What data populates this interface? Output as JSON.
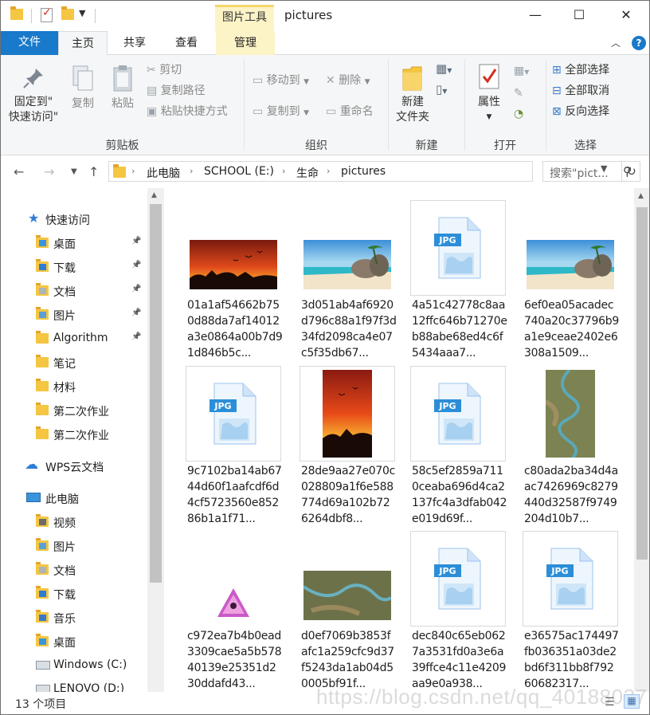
{
  "window": {
    "title": "pictures",
    "context_tab": "图片工具"
  },
  "tabs": {
    "file": "文件",
    "home": "主页",
    "share": "共享",
    "view": "查看",
    "manage": "管理"
  },
  "ribbon": {
    "clipboard": {
      "label": "剪贴板",
      "pin": "固定到\"\n快速访问\"",
      "pin_line1": "固定到\"",
      "pin_line2": "快速访问\"",
      "copy": "复制",
      "paste": "粘贴",
      "cut": "剪切",
      "copy_path": "复制路径",
      "paste_shortcut": "粘贴快捷方式"
    },
    "organize": {
      "label": "组织",
      "move_to": "移动到",
      "copy_to": "复制到",
      "delete": "删除",
      "rename": "重命名"
    },
    "new": {
      "label": "新建",
      "new_folder_line1": "新建",
      "new_folder_line2": "文件夹"
    },
    "open": {
      "label": "打开",
      "properties": "属性"
    },
    "select": {
      "label": "选择",
      "select_all": "全部选择",
      "select_none": "全部取消",
      "invert": "反向选择"
    }
  },
  "address": {
    "crumbs": [
      "此电脑",
      "SCHOOL (E:)",
      "生命",
      "pictures"
    ],
    "search_placeholder": "搜索\"pict..."
  },
  "nav": {
    "quick_access": "快速访问",
    "quick_items": [
      {
        "label": "桌面",
        "icon": "desktop-folder-icon",
        "pinned": true
      },
      {
        "label": "下载",
        "icon": "download-folder-icon",
        "pinned": true
      },
      {
        "label": "文档",
        "icon": "documents-folder-icon",
        "pinned": true
      },
      {
        "label": "图片",
        "icon": "pictures-folder-icon",
        "pinned": true
      },
      {
        "label": "Algorithm",
        "icon": "folder-icon",
        "pinned": true
      },
      {
        "label": "笔记",
        "icon": "folder-icon",
        "pinned": false
      },
      {
        "label": "材料",
        "icon": "folder-icon",
        "pinned": false
      },
      {
        "label": "第二次作业",
        "icon": "folder-icon",
        "pinned": false
      },
      {
        "label": "第二次作业",
        "icon": "folder-icon",
        "pinned": false
      }
    ],
    "wps": "WPS云文档",
    "this_pc": "此电脑",
    "pc_items": [
      {
        "label": "视频",
        "icon": "videos-folder-icon"
      },
      {
        "label": "图片",
        "icon": "pictures-folder-icon"
      },
      {
        "label": "文档",
        "icon": "documents-folder-icon"
      },
      {
        "label": "下载",
        "icon": "download-folder-icon"
      },
      {
        "label": "音乐",
        "icon": "music-folder-icon"
      },
      {
        "label": "桌面",
        "icon": "desktop-folder-icon"
      },
      {
        "label": "Windows (C:)",
        "icon": "drive-icon"
      },
      {
        "label": "LENOVO (D:)",
        "icon": "drive-icon"
      }
    ]
  },
  "files": [
    {
      "name": "01a1af54662b750d88da7af14012a3e0864a00b7d91d846b5c...",
      "thumb": "sunset"
    },
    {
      "name": "3d051ab4af6920d796c88a1f97f3d34fd2098ca4e07c5f35db67...",
      "thumb": "beach"
    },
    {
      "name": "4a51c42778c8aa12ffc646b71270eb88abe68ed4c6f5434aaa7...",
      "thumb": "jpg"
    },
    {
      "name": "6ef0ea05acadec740a20c37796b9a1e9ceae2402e6308a1509...",
      "thumb": "beach"
    },
    {
      "name": "9c7102ba14ab6744d60f1aafcdf6d4cf5723560e85286b1a1f71...",
      "thumb": "jpg"
    },
    {
      "name": "28de9aa27e070c028809a1f6e588774d69a102b726264dbf8...",
      "thumb": "sunset-tall"
    },
    {
      "name": "58c5ef2859a7110ceaba696d4ca2137fc4a3dfab042e019d69f...",
      "thumb": "jpg"
    },
    {
      "name": "c80ada2ba34d4aac7426969c8279440d32587f9749204d10b7...",
      "thumb": "canyon-tall"
    },
    {
      "name": "c972ea7b4b0ead3309cae5a5b57840139e25351d230ddafd43...",
      "thumb": "app"
    },
    {
      "name": "d0ef7069b3853fafc1a259cfc9d37f5243da1ab04d50005bf91f...",
      "thumb": "canyon"
    },
    {
      "name": "dec840c65eb0627a3531fd0a3e6a39ffce4c11e4209aa9e0a938...",
      "thumb": "jpg"
    },
    {
      "name": "e36575ac174497fb036351a03de2bd6f311bb8f79260682317...",
      "thumb": "jpg"
    }
  ],
  "jpg_badge": "JPG",
  "status": {
    "count": "13 个项目"
  },
  "watermark": "https://blog.csdn.net/qq_40188037",
  "colors": {
    "accent": "#1979ca",
    "context_tab": "#fcf3c6",
    "folder": "#f5c642"
  }
}
